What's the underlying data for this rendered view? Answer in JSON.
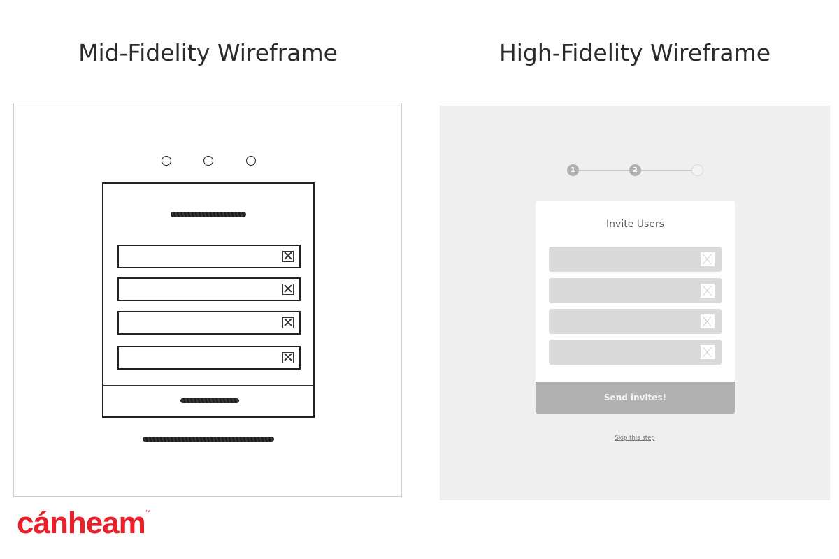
{
  "headings": {
    "mid": "Mid-Fidelity Wireframe",
    "high": "High-Fidelity Wireframe"
  },
  "mid_fidelity": {
    "step_dots": 3,
    "title_placeholder": "scribble",
    "fields": [
      {
        "remove_icon": "x-box-icon"
      },
      {
        "remove_icon": "x-box-icon"
      },
      {
        "remove_icon": "x-box-icon"
      },
      {
        "remove_icon": "x-box-icon"
      }
    ],
    "button_placeholder": "scribble",
    "link_placeholder": "scribble"
  },
  "high_fidelity": {
    "steps": [
      {
        "label": "1",
        "state": "done"
      },
      {
        "label": "2",
        "state": "done"
      },
      {
        "label": "",
        "state": "todo"
      }
    ],
    "card_title": "Invite Users",
    "fields": [
      {
        "value": "",
        "remove_icon": "close-icon"
      },
      {
        "value": "",
        "remove_icon": "close-icon"
      },
      {
        "value": "",
        "remove_icon": "close-icon"
      },
      {
        "value": "",
        "remove_icon": "close-icon"
      }
    ],
    "send_button": "Send invites!",
    "skip_link": "Skip this step"
  },
  "logo": {
    "text": "cánheam",
    "trademark": "™",
    "color": "#e8202a"
  }
}
